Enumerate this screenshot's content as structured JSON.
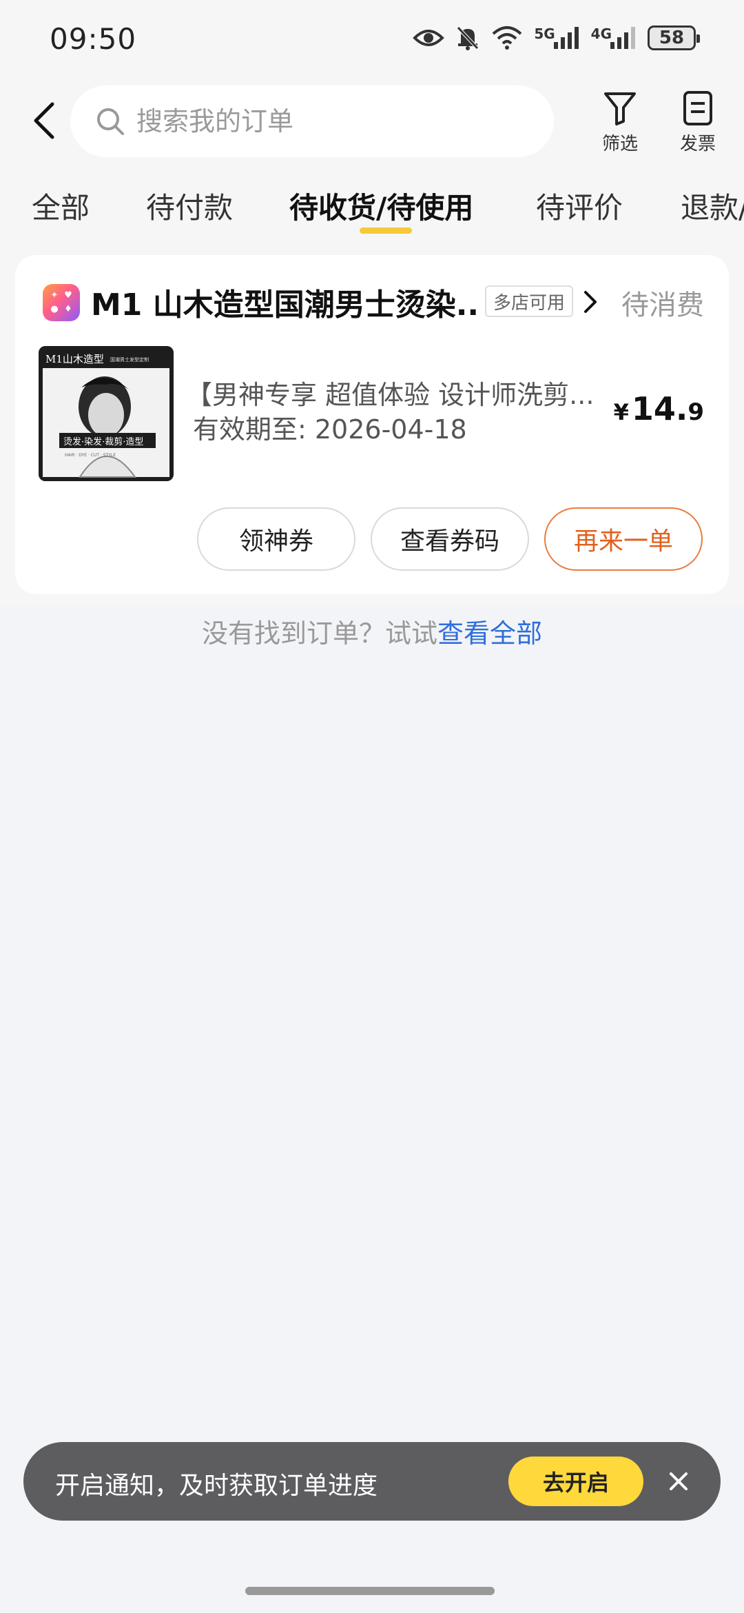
{
  "status_bar": {
    "time": "09:50",
    "net1": "5G",
    "net2": "4G",
    "battery": "58",
    "icons": [
      "eye-icon",
      "bell-muted-icon",
      "wifi-icon",
      "signal-5g-icon",
      "signal-4g-icon",
      "battery-icon"
    ]
  },
  "header": {
    "search_placeholder": "搜索我的订单",
    "filter_label": "筛选",
    "invoice_label": "发票"
  },
  "tabs": [
    {
      "label": "全部"
    },
    {
      "label": "待付款"
    },
    {
      "label": "待收货/待使用"
    },
    {
      "label": "待评价"
    },
    {
      "label": "退款/"
    }
  ],
  "active_tab": "待收货/待使用",
  "order": {
    "shop_name": "M1 山木造型国潮男士烫染..",
    "multi_store": "多店可用",
    "status": "待消费",
    "product_title": "【男神专享 超值体验 设计师洗剪...",
    "validity": "有效期至: 2026-04-18",
    "price_currency": "¥",
    "price_int": "14.",
    "price_dec": "9",
    "image_text": {
      "top": "M1山木造型",
      "sub": "国潮男士发型定制",
      "mid": "烫发·染发·裁剪·造型",
      "bottom": "HAIR · DYE · CUT · STYLE"
    },
    "buttons": {
      "coupon": "领神券",
      "code": "查看券码",
      "reorder": "再来一单"
    }
  },
  "not_found": {
    "text": "没有找到订单？试试",
    "link": "查看全部"
  },
  "notify": {
    "text": "开启通知，及时获取订单进度",
    "button": "去开启"
  },
  "colors": {
    "accent_yellow": "#f6c93a",
    "reorder_orange": "#e2611d",
    "link_blue": "#2f6fdb",
    "notify_bg": "#5d5d60",
    "notify_btn": "#ffd83b"
  }
}
